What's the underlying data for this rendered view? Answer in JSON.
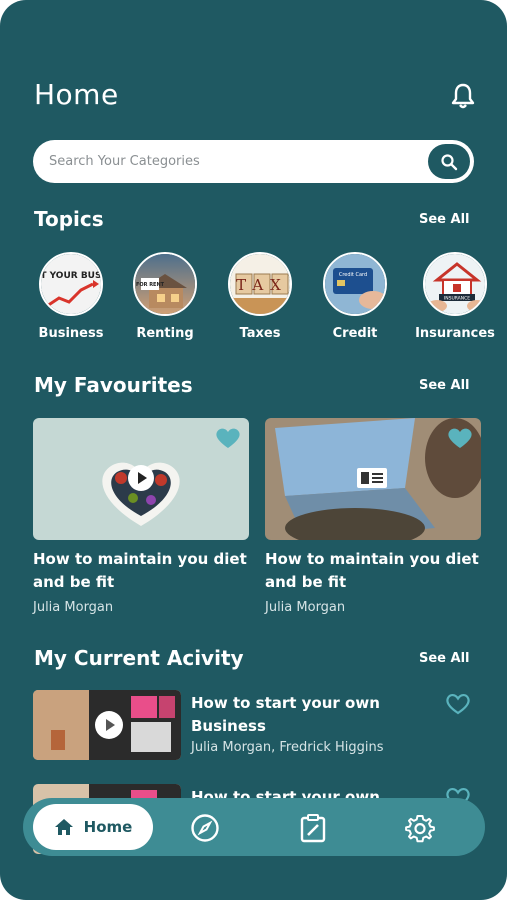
{
  "header": {
    "title": "Home"
  },
  "search": {
    "placeholder": "Search Your Categories"
  },
  "topics": {
    "title": "Topics",
    "see_all": "See All",
    "items": [
      {
        "label": "Business",
        "icon": "business-thumbnail",
        "caption": "START YOUR BUSINESS"
      },
      {
        "label": "Renting",
        "icon": "house-for-rent-thumbnail",
        "caption": "FOR RENT"
      },
      {
        "label": "Taxes",
        "icon": "tax-blocks-thumbnail",
        "caption": "TAX"
      },
      {
        "label": "Credit",
        "icon": "credit-card-thumbnail",
        "caption": "Credit Card"
      },
      {
        "label": "Insurances",
        "icon": "house-insurance-thumbnail",
        "caption": "INSURANCE"
      }
    ]
  },
  "favourites": {
    "title": "My Favourites",
    "see_all": "See All",
    "items": [
      {
        "title": "How to maintain you diet and be fit",
        "author": "Julia Morgan",
        "media": "video"
      },
      {
        "title": "How to maintain you diet and be fit",
        "author": "Julia Morgan",
        "media": "article"
      }
    ]
  },
  "activity": {
    "title": "My Current Acivity",
    "see_all": "See All",
    "items": [
      {
        "title": "How to start your own Business",
        "author": "Julia Morgan, Fredrick Higgins"
      },
      {
        "title": "How to start your own",
        "author": ""
      }
    ]
  },
  "nav": {
    "home_label": "Home"
  },
  "colors": {
    "background": "#1f5962",
    "accent": "#3e8c94",
    "heart": "#5ab3bd"
  }
}
